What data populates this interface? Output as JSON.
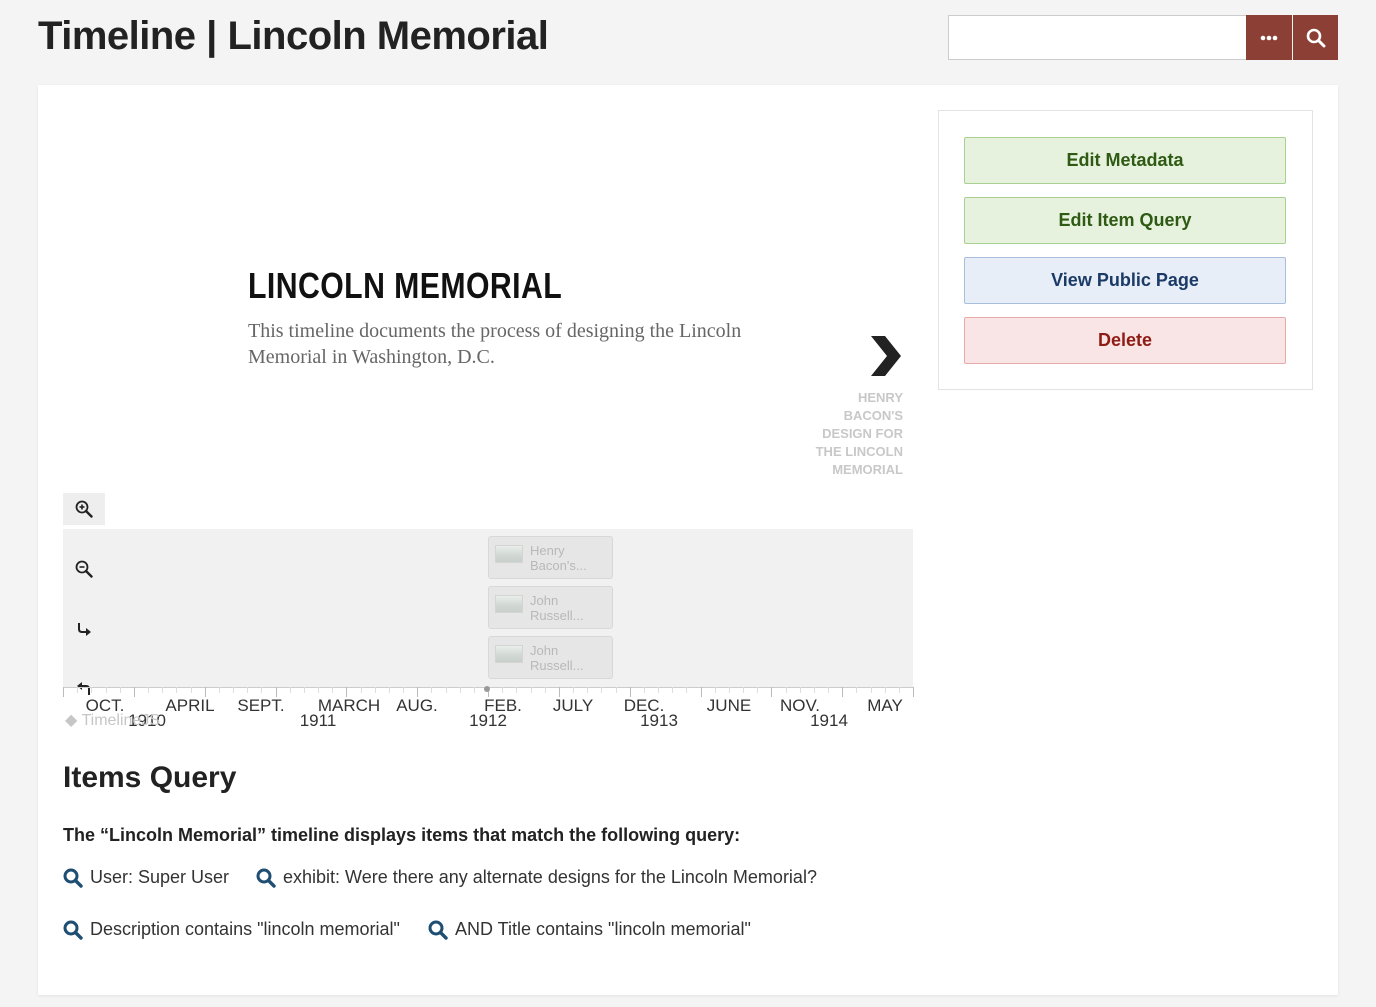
{
  "header": {
    "title": "Timeline | Lincoln Memorial",
    "search": {
      "value": "",
      "placeholder": ""
    },
    "options_icon": "ellipsis-icon",
    "search_icon": "search-icon"
  },
  "timeline": {
    "slide": {
      "title": "LINCOLN MEMORIAL",
      "text": "This timeline documents the process of designing the Lincoln Memorial in Washington, D.C."
    },
    "next_label": "HENRY BACON'S DESIGN FOR THE LINCOLN MEMORIAL",
    "tools": [
      "zoom-in-icon",
      "zoom-out-icon",
      "forward-icon",
      "back-icon"
    ],
    "markers": [
      {
        "label": "Henry Bacon's..."
      },
      {
        "label": "John Russell..."
      },
      {
        "label": "John Russell..."
      }
    ],
    "axis": {
      "months": [
        "OCT.",
        "APRIL",
        "SEPT.",
        "MARCH",
        "AUG.",
        "FEB.",
        "JULY",
        "DEC.",
        "JUNE",
        "NOV.",
        "MAY"
      ],
      "years": [
        "1910",
        "1911",
        "1912",
        "1913",
        "1914"
      ]
    },
    "credit": "TimelineJS"
  },
  "sidebar": {
    "edit_metadata": "Edit Metadata",
    "edit_query": "Edit Item Query",
    "view_public": "View Public Page",
    "delete": "Delete",
    "colors": {
      "green": "#e6f2dd",
      "blue": "#e7eef8",
      "red": "#f9e5e5",
      "brand": "#8b3f35"
    }
  },
  "items_query": {
    "title": "Items Query",
    "description": "The “Lincoln Memorial” timeline displays items that match the following query:",
    "filters": [
      "User: Super User",
      "exhibit: Were there any alternate designs for the Lincoln Memorial?",
      "Description contains \"lincoln memorial\"",
      "AND Title contains \"lincoln memorial\""
    ]
  }
}
